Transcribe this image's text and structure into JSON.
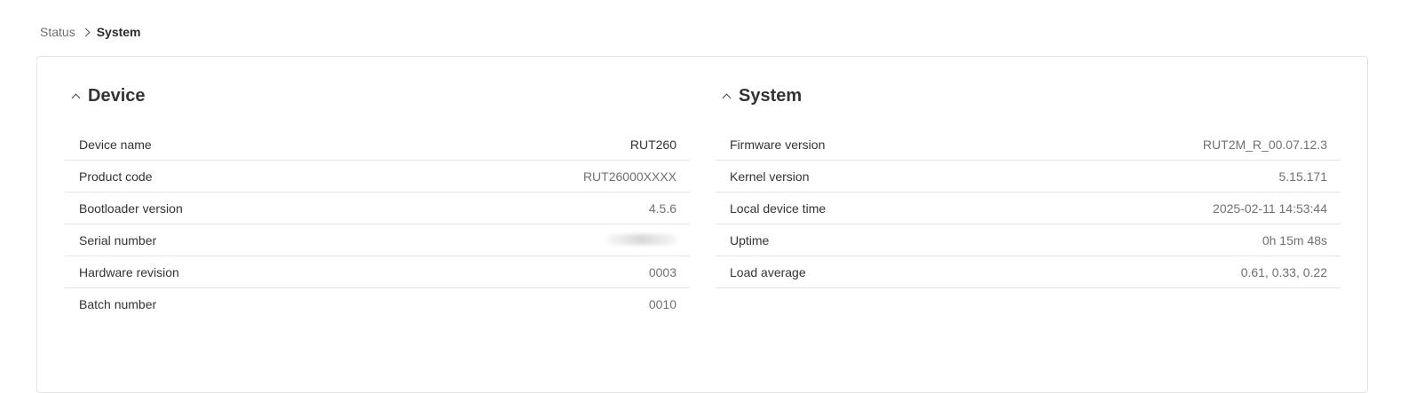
{
  "breadcrumb": {
    "parent": "Status",
    "current": "System"
  },
  "device": {
    "title": "Device",
    "rows": [
      {
        "label": "Device name",
        "value": "RUT260"
      },
      {
        "label": "Product code",
        "value": "RUT26000XXXX"
      },
      {
        "label": "Bootloader version",
        "value": "4.5.6"
      },
      {
        "label": "Serial number",
        "value": ""
      },
      {
        "label": "Hardware revision",
        "value": "0003"
      },
      {
        "label": "Batch number",
        "value": "0010"
      }
    ]
  },
  "system": {
    "title": "System",
    "rows": [
      {
        "label": "Firmware version",
        "value": "RUT2M_R_00.07.12.3"
      },
      {
        "label": "Kernel version",
        "value": "5.15.171"
      },
      {
        "label": "Local device time",
        "value": "2025-02-11 14:53:44"
      },
      {
        "label": "Uptime",
        "value": "0h 15m 48s"
      },
      {
        "label": "Load average",
        "value": "0.61, 0.33, 0.22"
      }
    ]
  }
}
